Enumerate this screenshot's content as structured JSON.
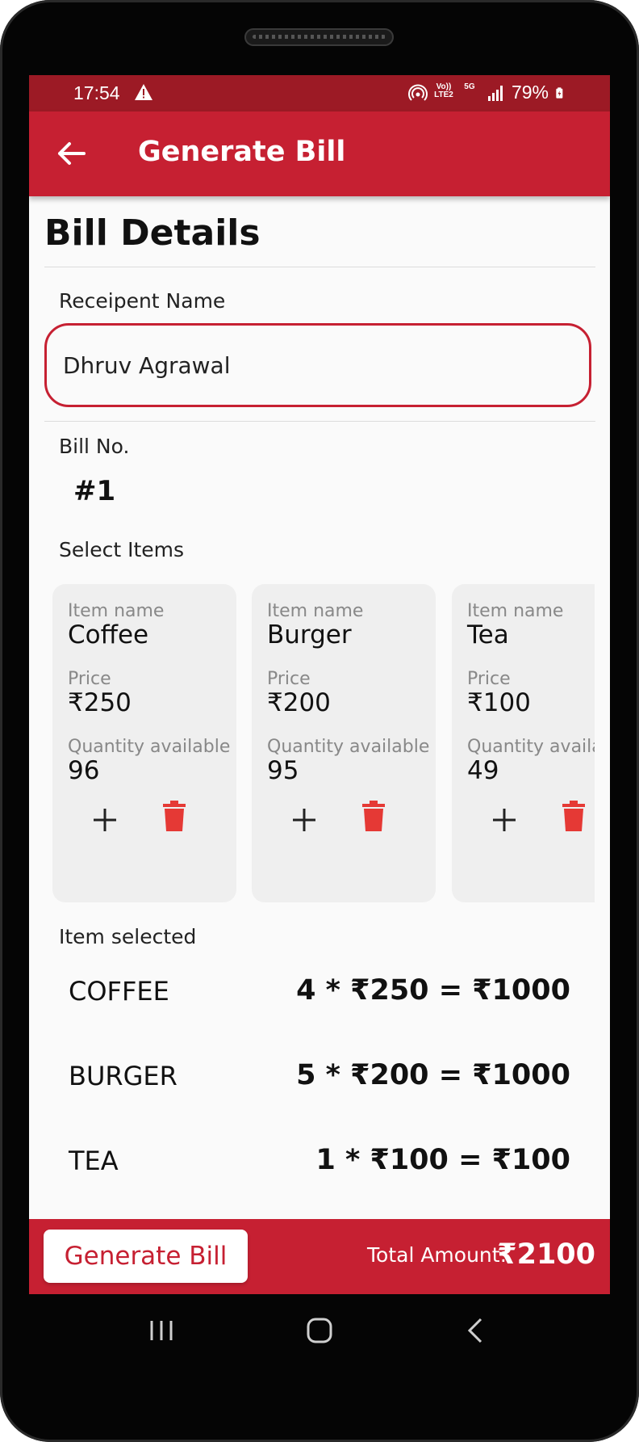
{
  "status_bar": {
    "time": "17:54",
    "warning_icon": "warning-triangle-icon",
    "battery": "79%",
    "network_5g": "5G",
    "volte": "Vo)) LTE2"
  },
  "app_bar": {
    "title": "Generate Bill",
    "back_icon": "arrow-left-icon"
  },
  "bill": {
    "section_title": "Bill Details",
    "recipient_label": "Receipent Name",
    "recipient_value": "Dhruv Agrawal",
    "bill_no_label": "Bill No.",
    "bill_no": "#1",
    "select_items_label": "Select Items",
    "item_selected_label": "Item selected"
  },
  "items": [
    {
      "name_caption": "Item name",
      "name": "Coffee",
      "price_caption": "Price",
      "price": "₹250",
      "qty_caption": "Quantity available",
      "qty": "96"
    },
    {
      "name_caption": "Item name",
      "name": "Burger",
      "price_caption": "Price",
      "price": "₹200",
      "qty_caption": "Quantity available",
      "qty": "95"
    },
    {
      "name_caption": "Item name",
      "name": "Tea",
      "price_caption": "Price",
      "price": "₹100",
      "qty_caption": "Quantity availa",
      "qty": "49"
    }
  ],
  "selected": [
    {
      "name": "COFFEE",
      "calc": "4 * ₹250 = ₹1000"
    },
    {
      "name": "BURGER",
      "calc": "5 * ₹200 = ₹1000"
    },
    {
      "name": "TEA",
      "calc": "1 * ₹100 = ₹100"
    }
  ],
  "footer": {
    "generate_label": "Generate Bill",
    "total_label": "Total Amount:",
    "total_value": "₹2100"
  },
  "colors": {
    "accent": "#c62032",
    "status_bar": "#9c1a25",
    "trash": "#e53935"
  }
}
